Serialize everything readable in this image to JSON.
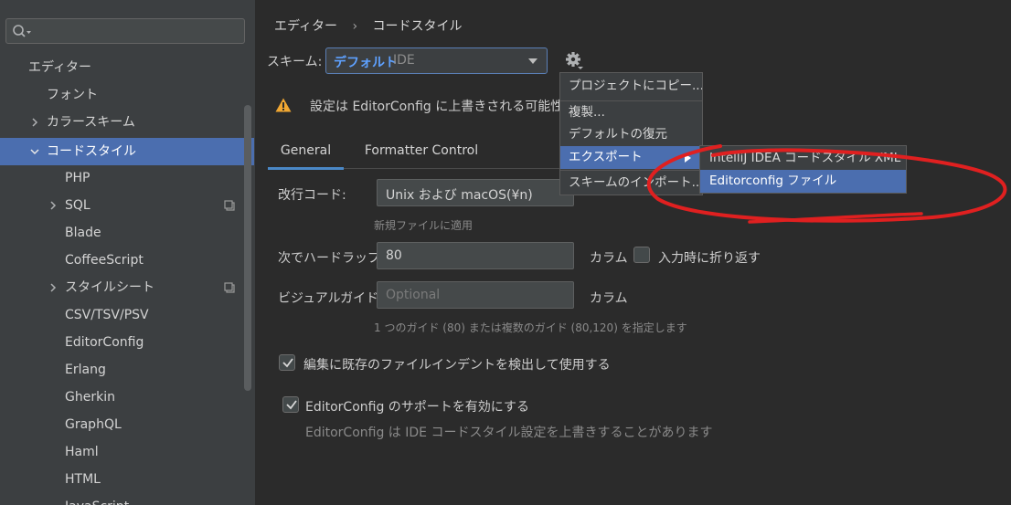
{
  "sidebar": {
    "search": {
      "placeholder": ""
    },
    "items": [
      {
        "label": "エディター",
        "indent": 0
      },
      {
        "label": "フォント",
        "indent": 1
      },
      {
        "label": "カラースキーム",
        "indent": 1,
        "expandable": true
      },
      {
        "label": "コードスタイル",
        "indent": 1,
        "expanded": true,
        "selected": true
      },
      {
        "label": "PHP",
        "indent": 2
      },
      {
        "label": "SQL",
        "indent": 2,
        "expandable": true,
        "copy_icon": true
      },
      {
        "label": "Blade",
        "indent": 2
      },
      {
        "label": "CoffeeScript",
        "indent": 2
      },
      {
        "label": "スタイルシート",
        "indent": 2,
        "expandable": true,
        "copy_icon": true
      },
      {
        "label": "CSV/TSV/PSV",
        "indent": 2
      },
      {
        "label": "EditorConfig",
        "indent": 2
      },
      {
        "label": "Erlang",
        "indent": 2
      },
      {
        "label": "Gherkin",
        "indent": 2
      },
      {
        "label": "GraphQL",
        "indent": 2
      },
      {
        "label": "Haml",
        "indent": 2
      },
      {
        "label": "HTML",
        "indent": 2
      },
      {
        "label": "JavaScript",
        "indent": 2
      }
    ]
  },
  "breadcrumb": {
    "parent": "エディター",
    "separator": "›",
    "current": "コードスタイル"
  },
  "scheme": {
    "label": "スキーム:",
    "value": "デフォルト",
    "type": "IDE"
  },
  "warning": {
    "text": "設定は EditorConfig に上書きされる可能性が"
  },
  "tabs": [
    {
      "label": "General",
      "active": true
    },
    {
      "label": "Formatter Control",
      "active": false
    }
  ],
  "form": {
    "line_separator": {
      "label": "改行コード:",
      "value": "Unix および macOS(¥n)",
      "hint": "新規ファイルに適用"
    },
    "hard_wrap": {
      "label": "次でハードラップ",
      "value": "80",
      "unit": "カラム",
      "wrap_on_typing_label": "入力時に折り返す",
      "wrap_on_typing": false
    },
    "visual_guides": {
      "label": "ビジュアルガイド:",
      "placeholder": "Optional",
      "unit": "カラム",
      "hint": "1 つのガイド (80) または複数のガイド (80,120) を指定します"
    },
    "detect_indent": {
      "label": "編集に既存のファイルインデントを検出して使用する",
      "checked": true
    },
    "editorconfig": {
      "label": "EditorConfig のサポートを有効にする",
      "checked": true,
      "hint": "EditorConfig は IDE コードスタイル設定を上書きすることがあります"
    }
  },
  "menu": {
    "items": [
      {
        "label": "プロジェクトにコピー..."
      },
      {
        "label": "複製..."
      },
      {
        "label": "デフォルトの復元"
      },
      {
        "label": "エクスポート",
        "highlighted": true,
        "has_submenu": true
      },
      {
        "label": "スキームのインポート..."
      }
    ],
    "submenu": [
      {
        "label": "IntelliJ IDEA コードスタイル XML"
      },
      {
        "label": "Editorconfig ファイル",
        "highlighted": true
      }
    ]
  },
  "colors": {
    "accent": "#4b6eaf",
    "annotation": "#e02020",
    "warning": "#f0a732",
    "link": "#5ea1ff"
  },
  "icons": [
    "search-icon",
    "chevron-right-icon",
    "chevron-down-icon",
    "copy-icon",
    "gear-icon",
    "warning-icon",
    "dropdown-arrow-icon",
    "checkmark-icon",
    "submenu-arrow-icon"
  ]
}
